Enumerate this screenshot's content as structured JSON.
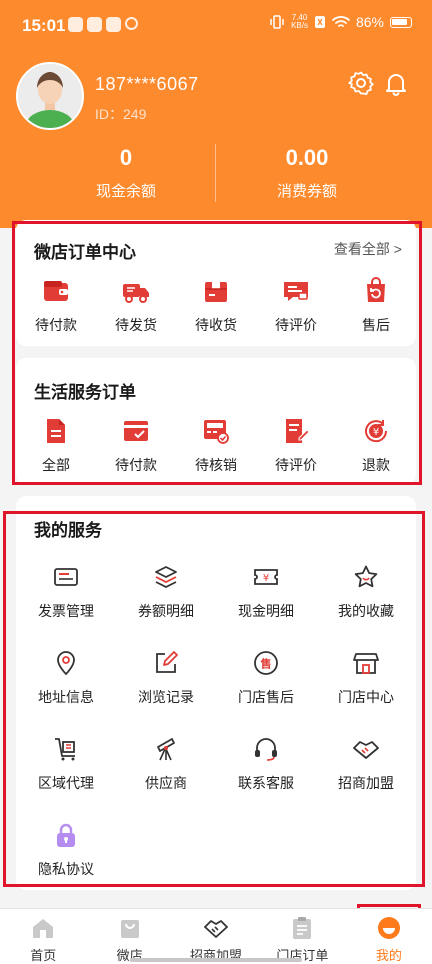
{
  "status_bar": {
    "time": "15:01",
    "net_speed_top": "7.40",
    "net_speed_bottom": "KB/s",
    "battery": "86%"
  },
  "profile": {
    "phone": "187****6067",
    "id_text": "ID：249"
  },
  "stats": [
    {
      "value": "0",
      "label": "现金余额"
    },
    {
      "value": "0.00",
      "label": "消费券额"
    }
  ],
  "shop_orders": {
    "title": "微店订单中心",
    "view_all": "查看全部 >",
    "items": [
      {
        "label": "待付款",
        "icon": "wallet-icon"
      },
      {
        "label": "待发货",
        "icon": "truck-icon"
      },
      {
        "label": "待收货",
        "icon": "package-icon"
      },
      {
        "label": "待评价",
        "icon": "comment-icon"
      },
      {
        "label": "售后",
        "icon": "return-bag-icon"
      }
    ]
  },
  "life_orders": {
    "title": "生活服务订单",
    "items": [
      {
        "label": "全部",
        "icon": "document-icon"
      },
      {
        "label": "待付款",
        "icon": "card-check-icon"
      },
      {
        "label": "待核销",
        "icon": "register-icon"
      },
      {
        "label": "待评价",
        "icon": "note-edit-icon"
      },
      {
        "label": "退款",
        "icon": "refund-icon"
      }
    ]
  },
  "services": {
    "title": "我的服务",
    "items": [
      {
        "label": "发票管理",
        "icon": "invoice-icon"
      },
      {
        "label": "券额明细",
        "icon": "layers-icon"
      },
      {
        "label": "现金明细",
        "icon": "yuan-ticket-icon"
      },
      {
        "label": "我的收藏",
        "icon": "star-icon"
      },
      {
        "label": "地址信息",
        "icon": "location-pin-icon"
      },
      {
        "label": "浏览记录",
        "icon": "edit-square-icon"
      },
      {
        "label": "门店售后",
        "icon": "store-service-icon"
      },
      {
        "label": "门店中心",
        "icon": "storefront-icon"
      },
      {
        "label": "区域代理",
        "icon": "cart-icon"
      },
      {
        "label": "供应商",
        "icon": "telescope-icon"
      },
      {
        "label": "联系客服",
        "icon": "headset-icon"
      },
      {
        "label": "招商加盟",
        "icon": "handshake-icon"
      },
      {
        "label": "隐私协议",
        "icon": "lock-icon"
      }
    ]
  },
  "tabbar": {
    "items": [
      {
        "label": "首页",
        "icon": "home-icon"
      },
      {
        "label": "微店",
        "icon": "shopping-bag-icon"
      },
      {
        "label": "招商加盟",
        "icon": "handshake-icon"
      },
      {
        "label": "门店订单",
        "icon": "clipboard-icon"
      },
      {
        "label": "我的",
        "icon": "profile-icon"
      }
    ],
    "active": "我的"
  },
  "colors": {
    "brand_orange": "#fe8a2e",
    "accent_red": "#e0152b",
    "icon_red": "#e23c36",
    "active_tab": "#ff7a1a",
    "lock_purple": "#b58cf0"
  }
}
